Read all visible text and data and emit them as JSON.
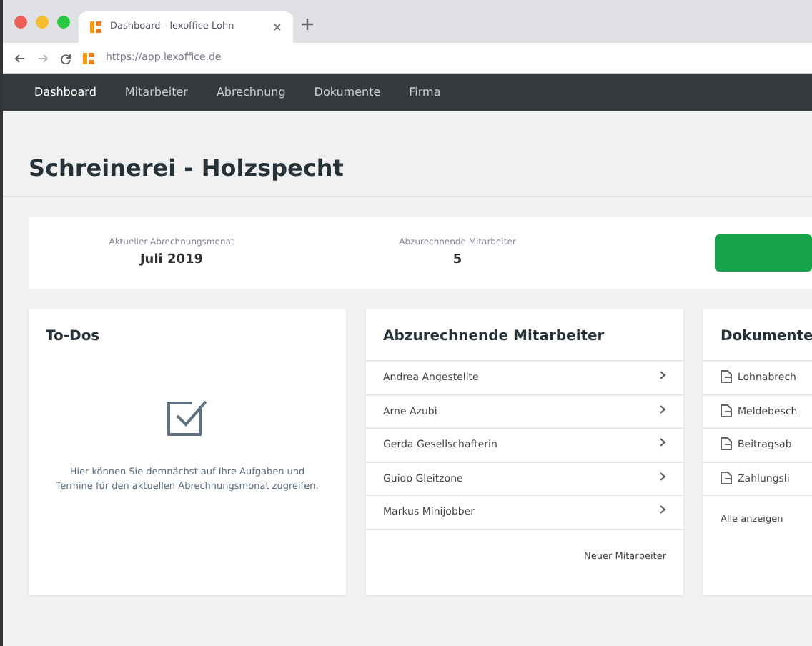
{
  "browser": {
    "tab_title": "Dashboard - lexoffice Lohn",
    "url": "https://app.lexoffice.de"
  },
  "nav": [
    {
      "label": "Dashboard",
      "selected": true
    },
    {
      "label": "Mitarbeiter",
      "selected": false
    },
    {
      "label": "Abrechnung",
      "selected": false
    },
    {
      "label": "Dokumente",
      "selected": false
    },
    {
      "label": "Firma",
      "selected": false
    }
  ],
  "page_title": "Schreinerei - Holzspecht",
  "stats": [
    {
      "label": "Aktueller Abrechnungsmonat",
      "value": "Juli 2019"
    },
    {
      "label": "Abzurechnende Mitarbeiter",
      "value": "5"
    }
  ],
  "todos": {
    "title": "To-Dos",
    "text": "Hier können Sie demnächst auf Ihre Aufgaben und Termine für den aktuellen Abrechnungsmonat zugreifen."
  },
  "employees": {
    "title": "Abzurechnende Mitarbeiter",
    "items": [
      "Andrea Angestellte",
      "Arne Azubi",
      "Gerda Gesellschafterin",
      "Guido Gleitzone",
      "Markus Minijobber"
    ],
    "footer_link": "Neuer Mitarbeiter"
  },
  "documents": {
    "title": "Dokumente",
    "items": [
      "Lohnabrech",
      "Meldebesch",
      "Beitragsab",
      "Zahlungsli"
    ],
    "footer_link": "Alle anzeigen"
  }
}
